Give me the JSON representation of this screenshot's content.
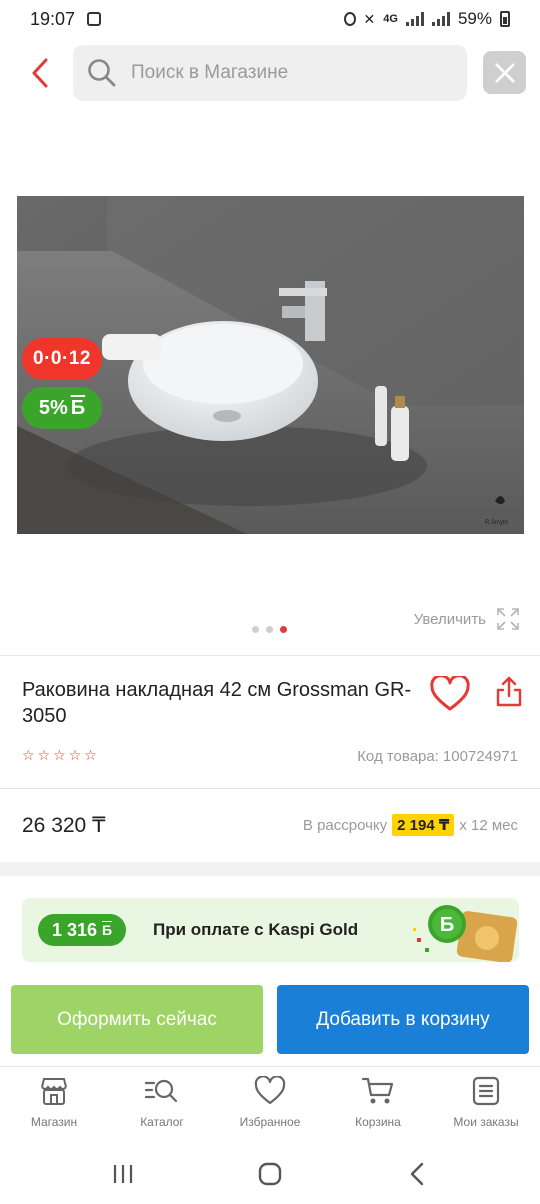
{
  "status_bar": {
    "time": "19:07",
    "network": "4G",
    "battery": "59%"
  },
  "search": {
    "placeholder": "Поиск в Магазине",
    "value": ""
  },
  "product": {
    "badge_installment": "0·0·12",
    "badge_bonus_percent": "5%",
    "bonus_currency": "Б",
    "image_brand": "R.Smyth",
    "zoom_label": "Увеличить",
    "gallery": {
      "count": 3,
      "active_index": 2
    },
    "title": "Раковина накладная 42 см Grossman GR-3050",
    "rating_stars": 0,
    "sku_label": "Код товара:",
    "sku_value": "100724971",
    "price": "26 320 ₸",
    "installment_prefix": "В рассрочку",
    "installment_amount": "2 194 ₸",
    "installment_suffix": "х 12 мес"
  },
  "kaspi_gold": {
    "bonus_amount": "1 316",
    "bonus_currency": "Б",
    "text": "При оплате с Kaspi Gold",
    "deco_symbol": "Б"
  },
  "actions": {
    "checkout": "Оформить сейчас",
    "add_to_cart": "Добавить в корзину"
  },
  "tabs": [
    {
      "label": "Магазин",
      "icon": "shop-icon"
    },
    {
      "label": "Каталог",
      "icon": "catalog-search-icon"
    },
    {
      "label": "Избранное",
      "icon": "heart-icon"
    },
    {
      "label": "Корзина",
      "icon": "cart-icon"
    },
    {
      "label": "Мои заказы",
      "icon": "orders-icon"
    }
  ],
  "colors": {
    "accent_red": "#e53935",
    "kaspi_green": "#3aa52a",
    "kaspi_blue": "#1a7fd6",
    "highlight_yellow": "#ffd200"
  }
}
